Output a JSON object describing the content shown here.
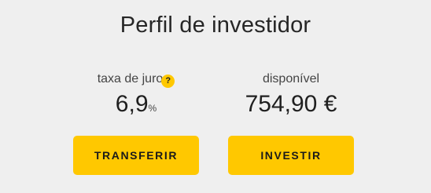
{
  "title": "Perfil de investidor",
  "rate": {
    "label": "taxa de juro",
    "help_glyph": "?",
    "value": "6,9",
    "unit": "%"
  },
  "available": {
    "label": "disponível",
    "value": "754,90 €"
  },
  "buttons": {
    "transfer": "TRANSFERIR",
    "invest": "INVESTIR"
  },
  "colors": {
    "background": "#efefef",
    "accent": "#ffc800",
    "text": "#222222"
  },
  "icons": {
    "help": "question-mark-icon"
  }
}
